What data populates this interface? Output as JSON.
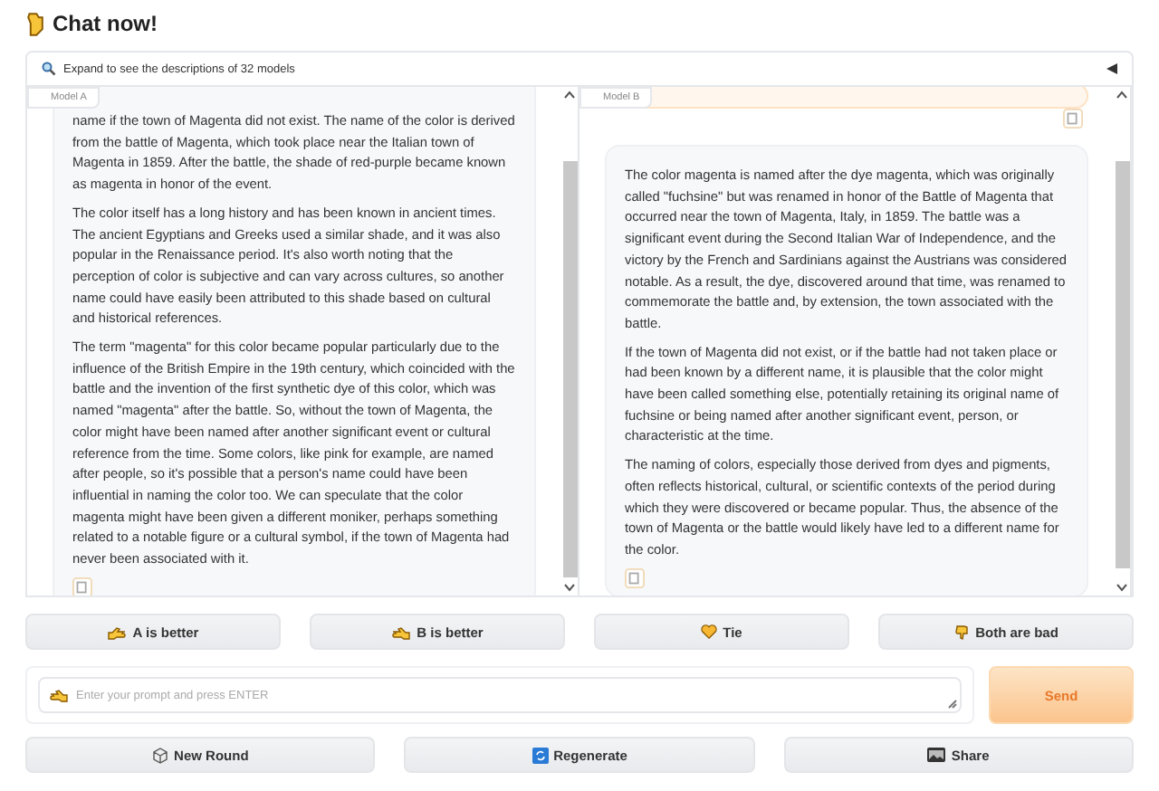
{
  "title": "Chat now!",
  "accordion": {
    "label": "Expand to see the descriptions of 32 models",
    "expanded": false
  },
  "panels": [
    {
      "label": "Model A",
      "messages": [
        {
          "kind": "bot",
          "paragraphs": [
            "name if the town of Magenta did not exist. The name of the color is derived from the battle of Magenta, which took place near the Italian town of Magenta in 1859. After the battle, the shade of red-purple became known as magenta in honor of the event.",
            "The color itself has a long history and has been known in ancient times. The ancient Egyptians and Greeks used a similar shade, and it was also popular in the Renaissance period. It's also worth noting that the perception of color is subjective and can vary across cultures, so another name could have easily been attributed to this shade based on cultural and historical references.",
            "The term \"magenta\" for this color became popular particularly due to the influence of the British Empire in the 19th century, which coincided with the battle and the invention of the first synthetic dye of this color, which was named \"magenta\" after the battle. So, without the town of Magenta, the color might have been named after another significant event or cultural reference from the time. Some colors, like pink for example, are named after people, so it's possible that a person's name could have been influential in naming the color too. We can speculate that the color magenta might have been given a different moniker, perhaps something related to a notable figure or a cultural symbol, if the town of Magenta had never been associated with it."
          ]
        }
      ]
    },
    {
      "label": "Model B",
      "messages": [
        {
          "kind": "user"
        },
        {
          "kind": "bot",
          "paragraphs": [
            "The color magenta is named after the dye magenta, which was originally called \"fuchsine\" but was renamed in honor of the Battle of Magenta that occurred near the town of Magenta, Italy, in 1859. The battle was a significant event during the Second Italian War of Independence, and the victory by the French and Sardinians against the Austrians was considered notable. As a result, the dye, discovered around that time, was renamed to commemorate the battle and, by extension, the town associated with the battle.",
            "If the town of Magenta did not exist, or if the battle had not taken place or had been known by a different name, it is plausible that the color might have been called something else, potentially retaining its original name of fuchsine or being named after another significant event, person, or characteristic at the time.",
            "The naming of colors, especially those derived from dyes and pigments, often reflects historical, cultural, or scientific contexts of the period during which they were discovered or became popular. Thus, the absence of the town of Magenta or the battle would likely have led to a different name for the color."
          ]
        }
      ]
    }
  ],
  "vote_buttons": [
    {
      "label": "A is better",
      "kind": "left"
    },
    {
      "label": "B is better",
      "kind": "right"
    },
    {
      "label": "Tie",
      "kind": "heart"
    },
    {
      "label": "Both are bad",
      "kind": "down"
    }
  ],
  "input": {
    "placeholder": "Enter your prompt and press ENTER"
  },
  "send_button": "Send",
  "actions": [
    {
      "label": "New Round",
      "kind": "cube"
    },
    {
      "label": "Regenerate",
      "kind": "refresh"
    },
    {
      "label": "Share",
      "kind": "share"
    }
  ]
}
